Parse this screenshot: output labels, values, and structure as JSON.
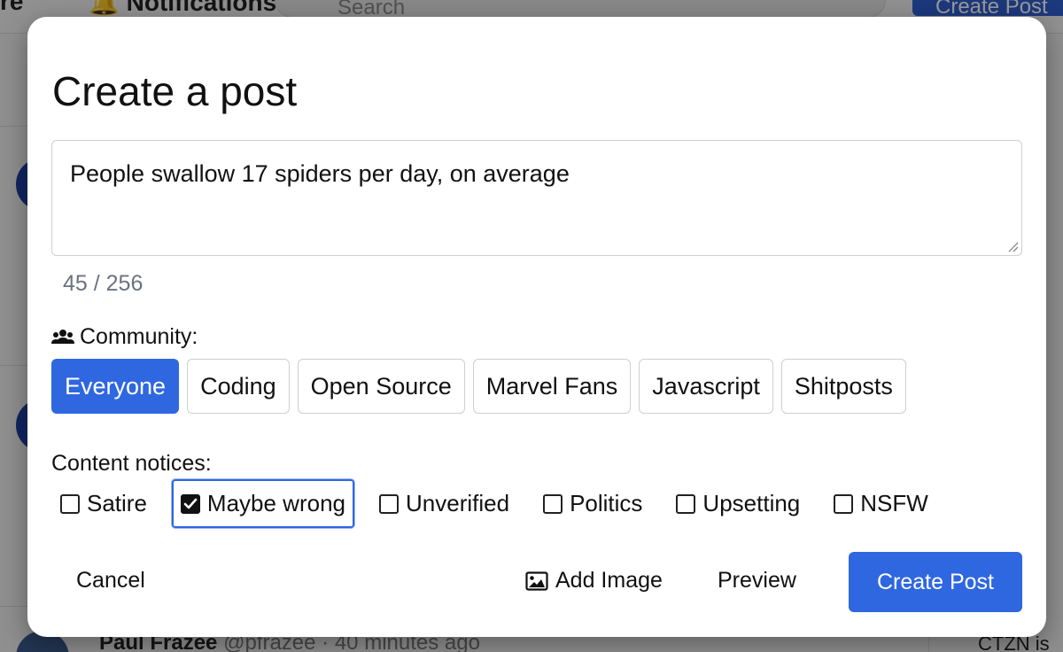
{
  "background": {
    "nav_partial": "re",
    "notifications_label": "Notifications",
    "search_placeholder": "Search",
    "create_post_label": "Create Post",
    "post_author": "Paul Frazee",
    "post_handle": "@pfrazee",
    "post_time": "· 40 minutes ago",
    "right_text": "CTZN is c"
  },
  "modal": {
    "title": "Create a post",
    "textarea_value": "People swallow 17 spiders per day, on average",
    "char_count": "45 / 256",
    "community_label": "Community:",
    "communities": [
      {
        "label": "Everyone",
        "selected": true
      },
      {
        "label": "Coding",
        "selected": false
      },
      {
        "label": "Open Source",
        "selected": false
      },
      {
        "label": "Marvel Fans",
        "selected": false
      },
      {
        "label": "Javascript",
        "selected": false
      },
      {
        "label": "Shitposts",
        "selected": false
      }
    ],
    "notices_label": "Content notices:",
    "notices": [
      {
        "label": "Satire",
        "checked": false
      },
      {
        "label": "Maybe wrong",
        "checked": true
      },
      {
        "label": "Unverified",
        "checked": false
      },
      {
        "label": "Politics",
        "checked": false
      },
      {
        "label": "Upsetting",
        "checked": false
      },
      {
        "label": "NSFW",
        "checked": false
      }
    ],
    "cancel_label": "Cancel",
    "add_image_label": "Add Image",
    "preview_label": "Preview",
    "create_label": "Create Post"
  },
  "colors": {
    "accent": "#2f67e0",
    "muted_text": "#6b7280"
  }
}
